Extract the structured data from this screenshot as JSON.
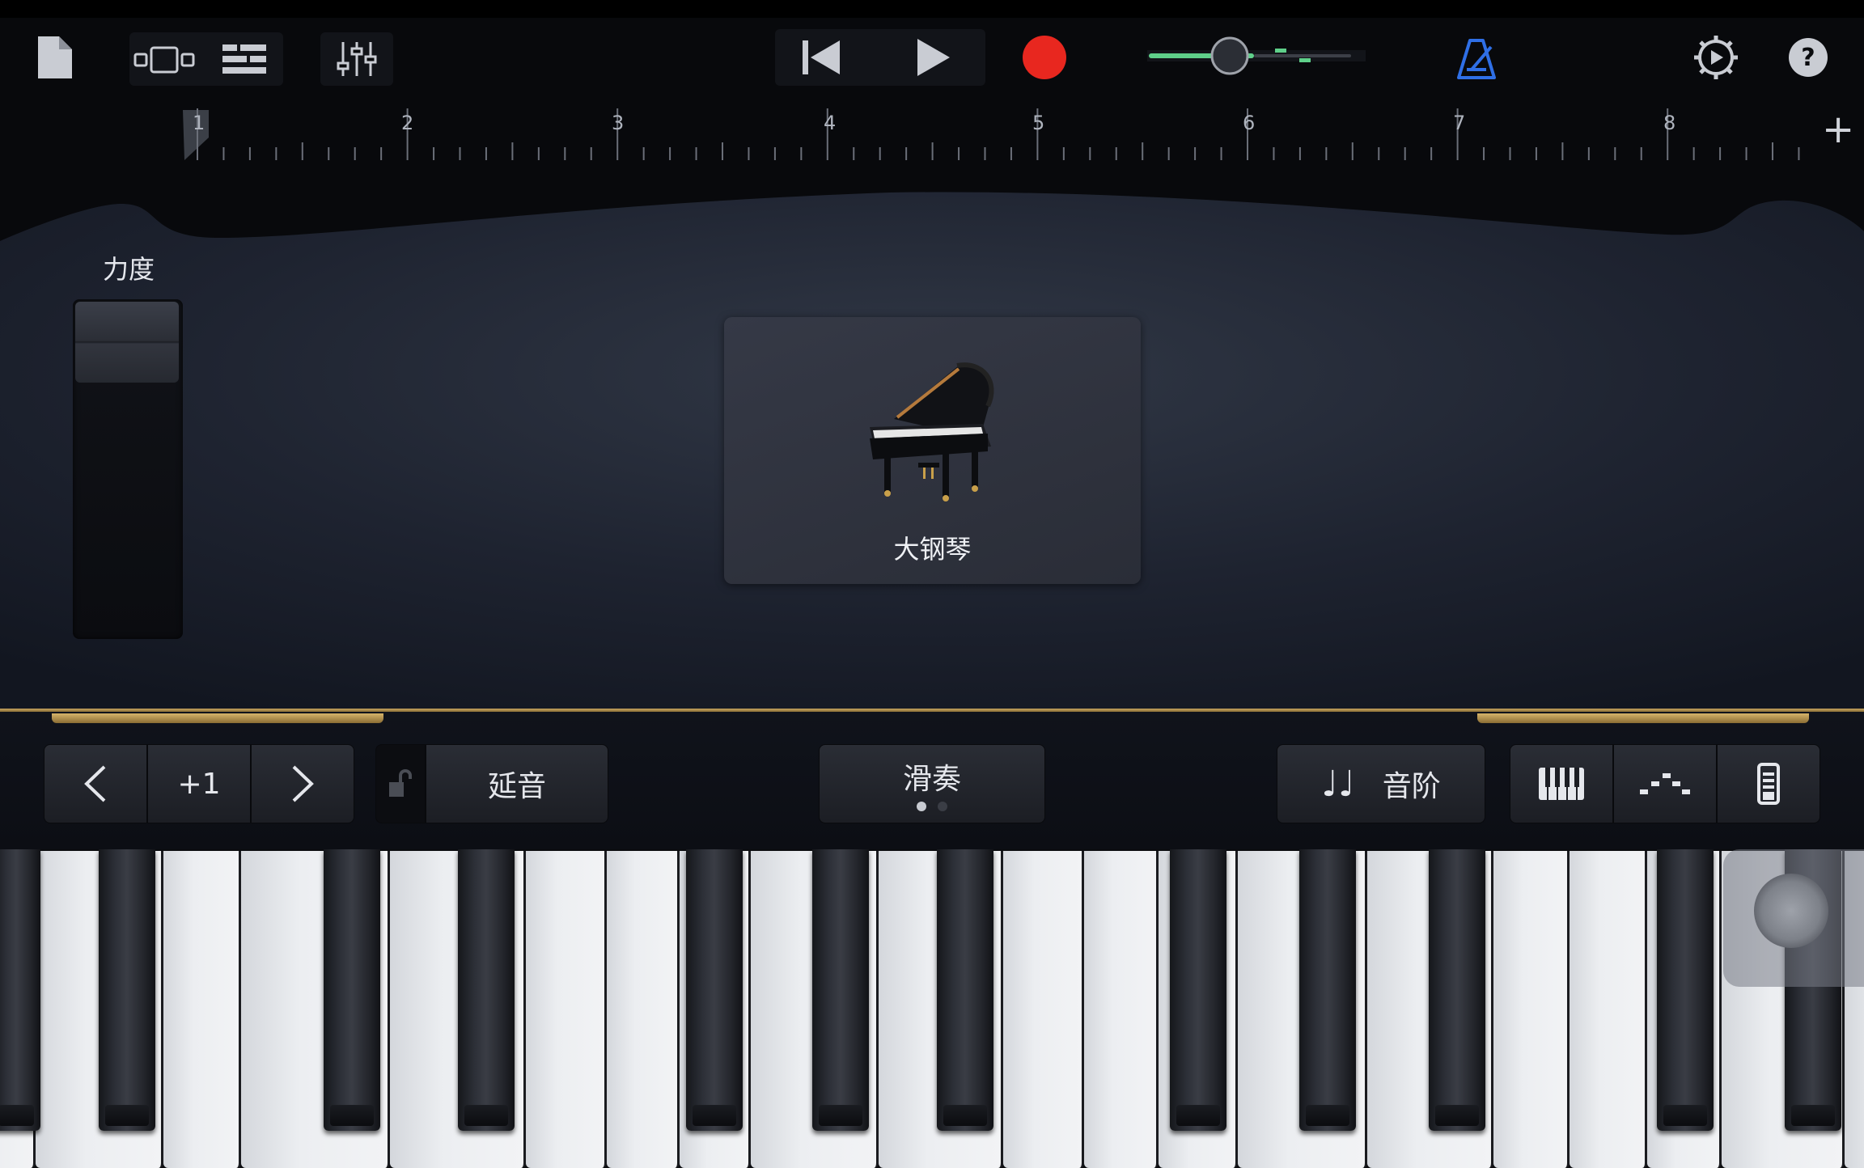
{
  "toolbar": {
    "icons": [
      "document-icon",
      "tracks-view-icon",
      "browser-list-icon",
      "mixer-icon",
      "rewind-icon",
      "play-icon",
      "record-icon",
      "master-volume-slider",
      "metronome-icon",
      "settings-icon",
      "help-icon"
    ],
    "master_volume": 0.55,
    "accent_colors": {
      "record": "#e8271f",
      "volume": "#5fd08a",
      "metronome": "#2f6fe6"
    }
  },
  "ruler": {
    "bars": [
      "1",
      "2",
      "3",
      "4",
      "5",
      "6",
      "7",
      "8"
    ],
    "add_label": "+"
  },
  "stage": {
    "velocity_label": "力度",
    "instrument_name": "大钢琴"
  },
  "controls": {
    "octave_down": "<",
    "octave_value": "+1",
    "octave_up": ">",
    "sustain_label": "延音",
    "glissando_label": "滑奏",
    "glissando_page": 1,
    "glissando_pages": 2,
    "scale_icon": "♩♩",
    "scale_label": "音阶",
    "keyboard_icons": [
      "piano-keys-icon",
      "arpeggiator-icon",
      "keyboard-size-icon"
    ]
  }
}
